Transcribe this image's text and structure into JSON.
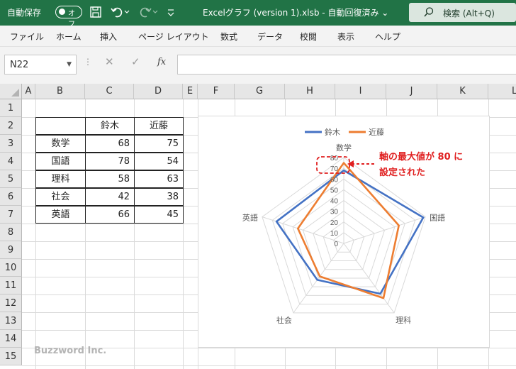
{
  "titlebar": {
    "autosave_label": "自動保存",
    "toggle_text": "オフ",
    "doc_title": "Excelグラフ (version 1).xlsb  -  自動回復済み ⌄",
    "search_text": "検索 (Alt+Q)"
  },
  "menu": [
    "ファイル",
    "ホーム",
    "挿入",
    "ページ レイアウト",
    "数式",
    "データ",
    "校閲",
    "表示",
    "ヘルプ"
  ],
  "formula_bar": {
    "name_box": "N22",
    "cancel_glyph": "✕",
    "enter_glyph": "✓",
    "fx_glyph": "fx",
    "value": ""
  },
  "grid": {
    "columns": [
      "A",
      "B",
      "C",
      "D",
      "E",
      "F",
      "G",
      "H",
      "I",
      "J",
      "K",
      "L"
    ],
    "rows": [
      "1",
      "2",
      "3",
      "4",
      "5",
      "6",
      "7",
      "8",
      "9",
      "10",
      "11",
      "12",
      "13",
      "14",
      "15"
    ]
  },
  "table": {
    "headers": [
      "",
      "鈴木",
      "近藤"
    ],
    "rows": [
      {
        "subject": "数学",
        "suzuki": "68",
        "kondo": "75"
      },
      {
        "subject": "国語",
        "suzuki": "78",
        "kondo": "54"
      },
      {
        "subject": "理科",
        "suzuki": "58",
        "kondo": "63"
      },
      {
        "subject": "社会",
        "suzuki": "42",
        "kondo": "38"
      },
      {
        "subject": "英語",
        "suzuki": "66",
        "kondo": "45"
      }
    ]
  },
  "chart_data": {
    "type": "radar",
    "categories": [
      "数学",
      "国語",
      "理科",
      "社会",
      "英語"
    ],
    "series": [
      {
        "name": "鈴木",
        "values": [
          68,
          78,
          58,
          42,
          66
        ],
        "color": "#4472c4"
      },
      {
        "name": "近藤",
        "values": [
          75,
          54,
          63,
          38,
          45
        ],
        "color": "#ed7d31"
      }
    ],
    "rlim": [
      0,
      80
    ],
    "ticks": [
      "0",
      "10",
      "20",
      "30",
      "40",
      "50",
      "60",
      "70",
      "80"
    ],
    "legend_position": "top",
    "grid": true
  },
  "annotation": {
    "line1": "軸の最大値が 80 に",
    "line2": "設定された",
    "color": "#e02020"
  },
  "footer": {
    "brand": "Buzzword Inc."
  }
}
